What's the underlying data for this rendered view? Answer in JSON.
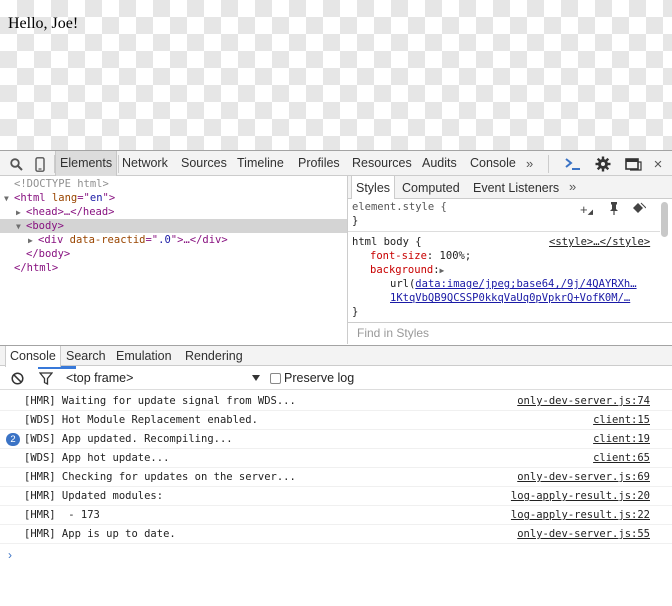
{
  "page": {
    "greeting": "Hello, Joe!"
  },
  "devtools": {
    "panels": [
      "Elements",
      "Network",
      "Sources",
      "Timeline",
      "Profiles",
      "Resources",
      "Audits",
      "Console"
    ],
    "selected_panel": "Elements",
    "more_symbol": "»",
    "icons": {
      "search": "search-icon",
      "device": "device-mode-icon",
      "console": "show-console-icon",
      "settings": "gear-icon",
      "dock": "dock-side-icon",
      "close": "close-icon"
    },
    "close_symbol": "×"
  },
  "dom_tree": {
    "doctype": "<!DOCTYPE html>",
    "html_open_tag": "<html",
    "html_lang_attr": " lang",
    "html_lang_eq": "=\"",
    "html_lang_val": "en",
    "html_lang_close": "\">",
    "head_text": "<head>…</head>",
    "body_open": "<body>",
    "div_open": "<div",
    "div_attr": " data-reactid",
    "div_eq": "=\"",
    "div_val": ".0",
    "div_close": "\">…</div>",
    "body_close": "</body>",
    "html_close": "</html>"
  },
  "breadcrumbs": [
    "html",
    "body"
  ],
  "styles": {
    "tabs": [
      "Styles",
      "Computed",
      "Event Listeners"
    ],
    "selected_tab": "Styles",
    "element_style_selector": "element.style {",
    "close_brace": "}",
    "rule_selector": "html body {",
    "rule_source": "<style>…</style>",
    "prop1_name": "font-size",
    "prop1_value": " 100%;",
    "prop2_name": "background",
    "url_prefix": "url(",
    "url_line1": "data:image/jpeg;base64,/9j/4QAYRXh…",
    "url_line2": "1KtqVbQB9QCSSP0kkqVaUq0pVpkrQ+VofK0M/…",
    "find_placeholder": "Find in Styles"
  },
  "drawer": {
    "tabs": [
      "Console",
      "Search",
      "Emulation",
      "Rendering"
    ],
    "selected_tab": "Console",
    "frame": "<top frame>",
    "preserve_log": "Preserve log",
    "preserve_checked": false
  },
  "console_messages": [
    {
      "text": "[HMR] Waiting for update signal from WDS...",
      "source": "only-dev-server.js:74",
      "count": ""
    },
    {
      "text": "[WDS] Hot Module Replacement enabled.",
      "source": "client:15",
      "count": ""
    },
    {
      "text": "[WDS] App updated. Recompiling...",
      "source": "client:19",
      "count": "2"
    },
    {
      "text": "[WDS] App hot update...",
      "source": "client:65",
      "count": ""
    },
    {
      "text": "[HMR] Checking for updates on the server...",
      "source": "only-dev-server.js:69",
      "count": ""
    },
    {
      "text": "[HMR] Updated modules:",
      "source": "log-apply-result.js:20",
      "count": ""
    },
    {
      "text": "[HMR]  - 173",
      "source": "log-apply-result.js:22",
      "count": ""
    },
    {
      "text": "[HMR] App is up to date.",
      "source": "only-dev-server.js:55",
      "count": ""
    }
  ],
  "prompt_symbol": "›"
}
